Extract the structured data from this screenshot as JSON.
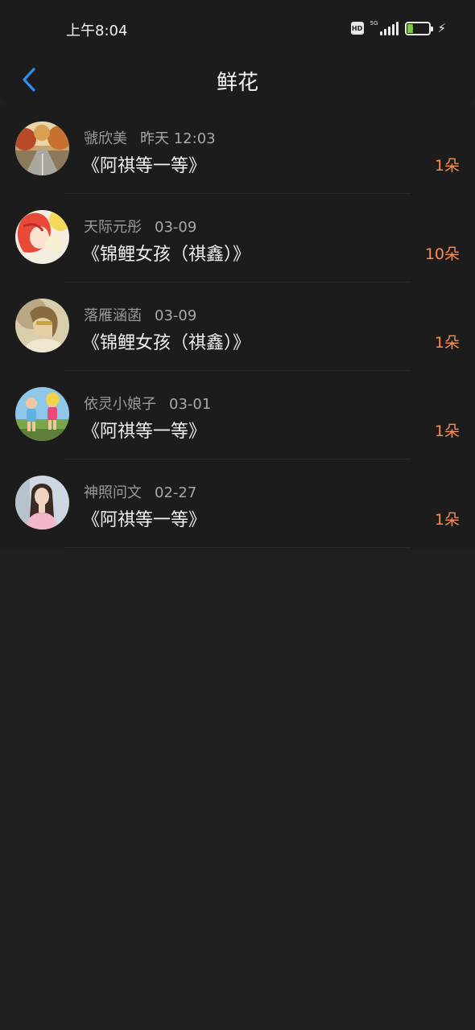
{
  "status_bar": {
    "time": "上午8:04",
    "hd_badge": "HD",
    "network": "5G",
    "battery_level": "28",
    "battery_fraction": 0.28,
    "icons": [
      "hd-icon",
      "signal-icon",
      "battery-icon",
      "charging-icon"
    ]
  },
  "nav": {
    "back_icon": "chevron-left-icon",
    "title": "鲜花"
  },
  "colors": {
    "accent": "#2b8ff0",
    "count": "#ff8a4c",
    "background": "#1f1f1f",
    "card": "#1c1c1c"
  },
  "gifts": [
    {
      "name": "虢欣美",
      "date": "昨天 12:03",
      "book": "《阿祺等一等》",
      "count": "1朵",
      "avatar": "autumn-road-avatar"
    },
    {
      "name": "天际元彤",
      "date": "03-09",
      "book": "《锦鲤女孩（祺鑫）》",
      "count": "10朵",
      "avatar": "anime-girl-avatar"
    },
    {
      "name": "落雁涵菡",
      "date": "03-09",
      "book": "《锦鲤女孩（祺鑫）》",
      "count": "1朵",
      "avatar": "blurred-girl-avatar"
    },
    {
      "name": "依灵小娘子",
      "date": "03-01",
      "book": "《阿祺等一等》",
      "count": "1朵",
      "avatar": "dolls-avatar"
    },
    {
      "name": "神照问文",
      "date": "02-27",
      "book": "《阿祺等一等》",
      "count": "1朵",
      "avatar": "girl-portrait-avatar"
    }
  ]
}
